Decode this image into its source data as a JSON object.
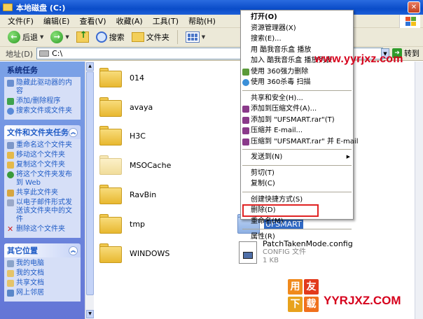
{
  "window": {
    "title": "本地磁盘 (C:)"
  },
  "menu": [
    "文件(F)",
    "编辑(E)",
    "查看(V)",
    "收藏(A)",
    "工具(T)",
    "帮助(H)"
  ],
  "toolbar": {
    "back": "后退",
    "search": "搜索",
    "folders": "文件夹"
  },
  "address": {
    "label": "地址(D)",
    "value": "C:\\",
    "go": "转到"
  },
  "taskpane": {
    "system": {
      "title": "系统任务",
      "items": [
        "隐藏此驱动器的内容",
        "添加/删除程序",
        "搜索文件或文件夹"
      ]
    },
    "file_tasks": {
      "title": "文件和文件夹任务",
      "items": [
        "重命名这个文件夹",
        "移动这个文件夹",
        "复制这个文件夹",
        "将这个文件夹发布到 Web",
        "共享此文件夹",
        "以电子邮件形式发送该文件夹中的文件",
        "删除这个文件夹"
      ]
    },
    "other": {
      "title": "其它位置",
      "items": [
        "我的电脑",
        "我的文档",
        "共享文档",
        "网上邻居"
      ]
    }
  },
  "files": [
    "014",
    "avaya",
    "H3C",
    "MSOCache",
    "RavBin",
    "tmp",
    "WINDOWS"
  ],
  "selected_folder": "UFSMART",
  "config_file": {
    "name": "PatchTakenMode.config",
    "type": "CONFIG 文件",
    "size": "1 KB"
  },
  "context_menu": {
    "open": "打开(O)",
    "explorer": "资源管理器(X)",
    "search": "搜索(E)...",
    "play": "用 酷我音乐盒 播放",
    "add_play": "加入 酷我音乐盒 播放列表",
    "delete360": "使用 360强力删除",
    "scan360": "使用 360杀毒 扫描",
    "share": "共享和安全(H)...",
    "add_archive": "添加到压缩文件(A)...",
    "add_ufsmart": "添加到 \"UFSMART.rar\"(T)",
    "compress_email": "压缩并 E-mail...",
    "compress_ufsmart_email": "压缩到 \"UFSMART.rar\" 并 E-mail",
    "send_to": "发送到(N)",
    "cut": "剪切(T)",
    "copy": "复制(C)",
    "shortcut": "创建快捷方式(S)",
    "delete": "删除(D)",
    "rename": "重命名(M)",
    "properties": "属性(R)"
  },
  "watermark": {
    "top": "www.yyrjxz.com",
    "logo_top": [
      "用",
      "友"
    ],
    "logo_bottom": [
      "下",
      "载"
    ],
    "brand": "YYRJXZ.COM"
  }
}
